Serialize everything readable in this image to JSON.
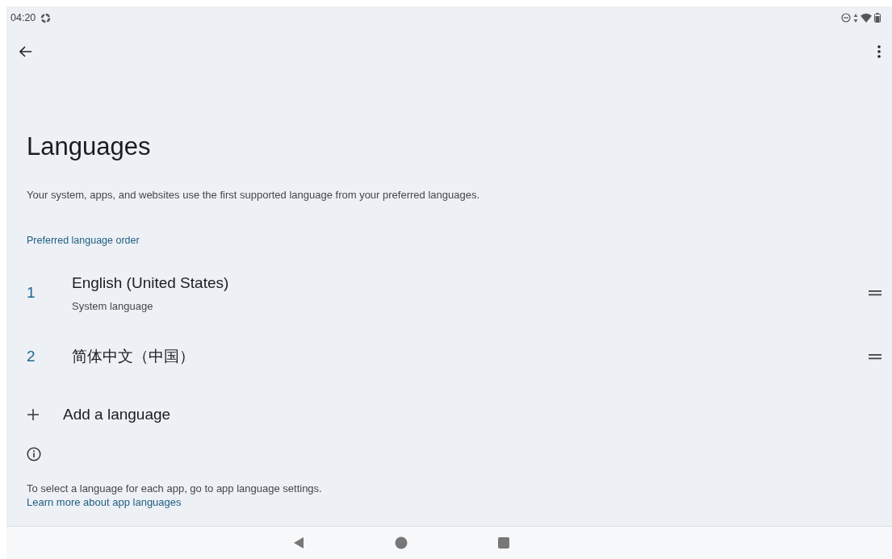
{
  "status_bar": {
    "time": "04:20"
  },
  "title": "Languages",
  "description": "Your system, apps, and websites use the first supported language from your preferred languages.",
  "section_header": "Preferred language order",
  "languages": [
    {
      "number": "1",
      "name": "English (United States)",
      "subtitle": "System language"
    },
    {
      "number": "2",
      "name": "简体中文（中国）"
    }
  ],
  "add_language": "Add a language",
  "footer_text": "To select a language for each app, go to app language settings.",
  "footer_link": "Learn more about app languages"
}
